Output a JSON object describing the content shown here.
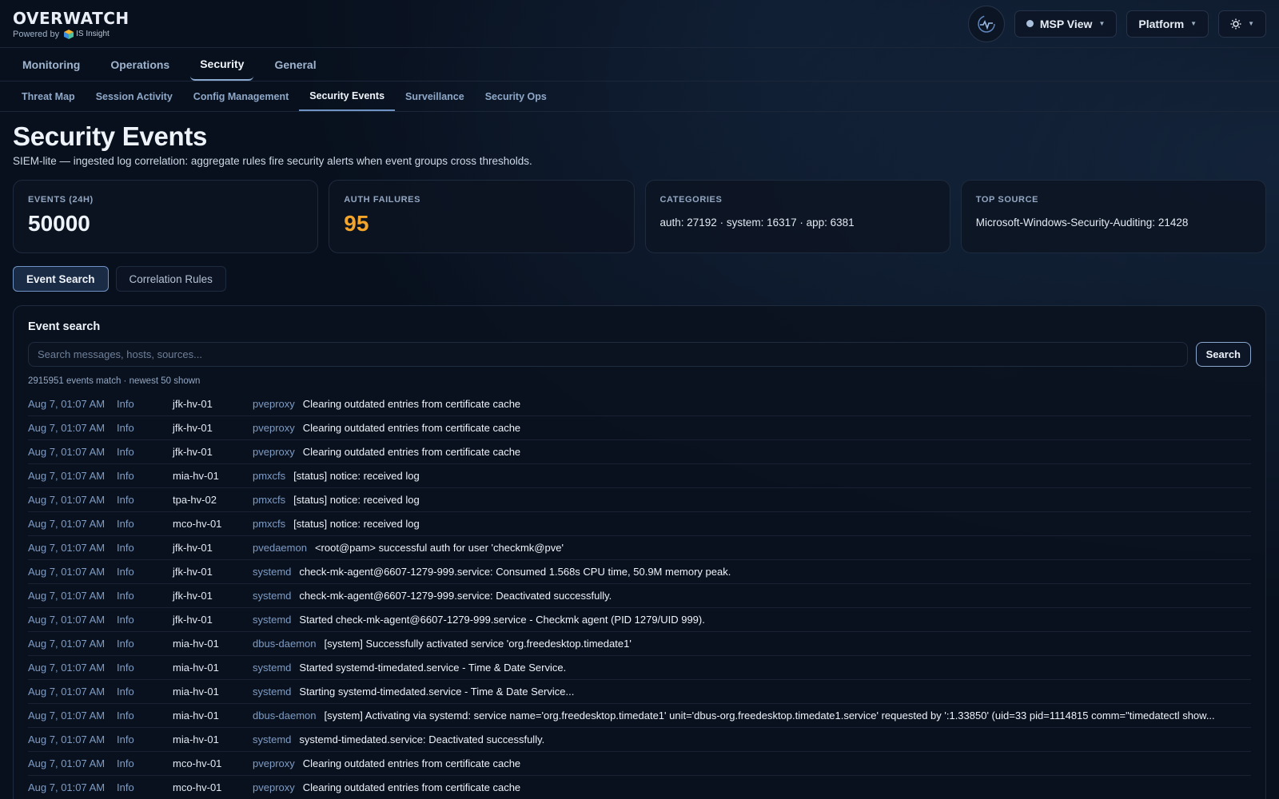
{
  "brand": {
    "title": "OVERWATCH",
    "powered_by": "Powered by",
    "partner": "IS Insight"
  },
  "header": {
    "view_select": "MSP View",
    "platform_select": "Platform"
  },
  "nav_primary": [
    {
      "label": "Monitoring",
      "active": false
    },
    {
      "label": "Operations",
      "active": false
    },
    {
      "label": "Security",
      "active": true
    },
    {
      "label": "General",
      "active": false
    }
  ],
  "nav_secondary": [
    {
      "label": "Threat Map",
      "active": false
    },
    {
      "label": "Session Activity",
      "active": false
    },
    {
      "label": "Config Management",
      "active": false
    },
    {
      "label": "Security Events",
      "active": true
    },
    {
      "label": "Surveillance",
      "active": false
    },
    {
      "label": "Security Ops",
      "active": false
    }
  ],
  "page": {
    "title": "Security Events",
    "description": "SIEM-lite — ingested log correlation: aggregate rules fire security alerts when event groups cross thresholds."
  },
  "stats": {
    "events": {
      "label": "EVENTS (24H)",
      "value": "50000"
    },
    "auth_failures": {
      "label": "AUTH FAILURES",
      "value": "95"
    },
    "categories": {
      "label": "CATEGORIES",
      "value": "auth: 27192 · system: 16317 · app: 6381"
    },
    "top_source": {
      "label": "TOP SOURCE",
      "value": "Microsoft-Windows-Security-Auditing: 21428"
    }
  },
  "view_tabs": {
    "event_search": "Event Search",
    "correlation_rules": "Correlation Rules",
    "active": "Event Search"
  },
  "event_search": {
    "title": "Event search",
    "placeholder": "Search messages, hosts, sources...",
    "button": "Search",
    "match_info": "2915951 events match · newest 50 shown",
    "events": [
      {
        "time": "Aug 7, 01:07 AM",
        "severity": "Info",
        "host": "jfk-hv-01",
        "source": "pveproxy",
        "message": "Clearing outdated entries from certificate cache"
      },
      {
        "time": "Aug 7, 01:07 AM",
        "severity": "Info",
        "host": "jfk-hv-01",
        "source": "pveproxy",
        "message": "Clearing outdated entries from certificate cache"
      },
      {
        "time": "Aug 7, 01:07 AM",
        "severity": "Info",
        "host": "jfk-hv-01",
        "source": "pveproxy",
        "message": "Clearing outdated entries from certificate cache"
      },
      {
        "time": "Aug 7, 01:07 AM",
        "severity": "Info",
        "host": "mia-hv-01",
        "source": "pmxcfs",
        "message": "[status] notice: received log"
      },
      {
        "time": "Aug 7, 01:07 AM",
        "severity": "Info",
        "host": "tpa-hv-02",
        "source": "pmxcfs",
        "message": "[status] notice: received log"
      },
      {
        "time": "Aug 7, 01:07 AM",
        "severity": "Info",
        "host": "mco-hv-01",
        "source": "pmxcfs",
        "message": "[status] notice: received log"
      },
      {
        "time": "Aug 7, 01:07 AM",
        "severity": "Info",
        "host": "jfk-hv-01",
        "source": "pvedaemon",
        "message": "<root@pam> successful auth for user 'checkmk@pve'"
      },
      {
        "time": "Aug 7, 01:07 AM",
        "severity": "Info",
        "host": "jfk-hv-01",
        "source": "systemd",
        "message": "check-mk-agent@6607-1279-999.service: Consumed 1.568s CPU time, 50.9M memory peak."
      },
      {
        "time": "Aug 7, 01:07 AM",
        "severity": "Info",
        "host": "jfk-hv-01",
        "source": "systemd",
        "message": "check-mk-agent@6607-1279-999.service: Deactivated successfully."
      },
      {
        "time": "Aug 7, 01:07 AM",
        "severity": "Info",
        "host": "jfk-hv-01",
        "source": "systemd",
        "message": "Started check-mk-agent@6607-1279-999.service - Checkmk agent (PID 1279/UID 999)."
      },
      {
        "time": "Aug 7, 01:07 AM",
        "severity": "Info",
        "host": "mia-hv-01",
        "source": "dbus-daemon",
        "message": "[system] Successfully activated service 'org.freedesktop.timedate1'"
      },
      {
        "time": "Aug 7, 01:07 AM",
        "severity": "Info",
        "host": "mia-hv-01",
        "source": "systemd",
        "message": "Started systemd-timedated.service - Time & Date Service."
      },
      {
        "time": "Aug 7, 01:07 AM",
        "severity": "Info",
        "host": "mia-hv-01",
        "source": "systemd",
        "message": "Starting systemd-timedated.service - Time & Date Service..."
      },
      {
        "time": "Aug 7, 01:07 AM",
        "severity": "Info",
        "host": "mia-hv-01",
        "source": "dbus-daemon",
        "message": "[system] Activating via systemd: service name='org.freedesktop.timedate1' unit='dbus-org.freedesktop.timedate1.service' requested by ':1.33850' (uid=33 pid=1114815 comm=\"timedatectl show..."
      },
      {
        "time": "Aug 7, 01:07 AM",
        "severity": "Info",
        "host": "mia-hv-01",
        "source": "systemd",
        "message": "systemd-timedated.service: Deactivated successfully."
      },
      {
        "time": "Aug 7, 01:07 AM",
        "severity": "Info",
        "host": "mco-hv-01",
        "source": "pveproxy",
        "message": "Clearing outdated entries from certificate cache"
      },
      {
        "time": "Aug 7, 01:07 AM",
        "severity": "Info",
        "host": "mco-hv-01",
        "source": "pveproxy",
        "message": "Clearing outdated entries from certificate cache"
      }
    ]
  },
  "colors": {
    "accent": "#8ba8cf",
    "warn": "#f3a42a",
    "background": "#08101d"
  }
}
